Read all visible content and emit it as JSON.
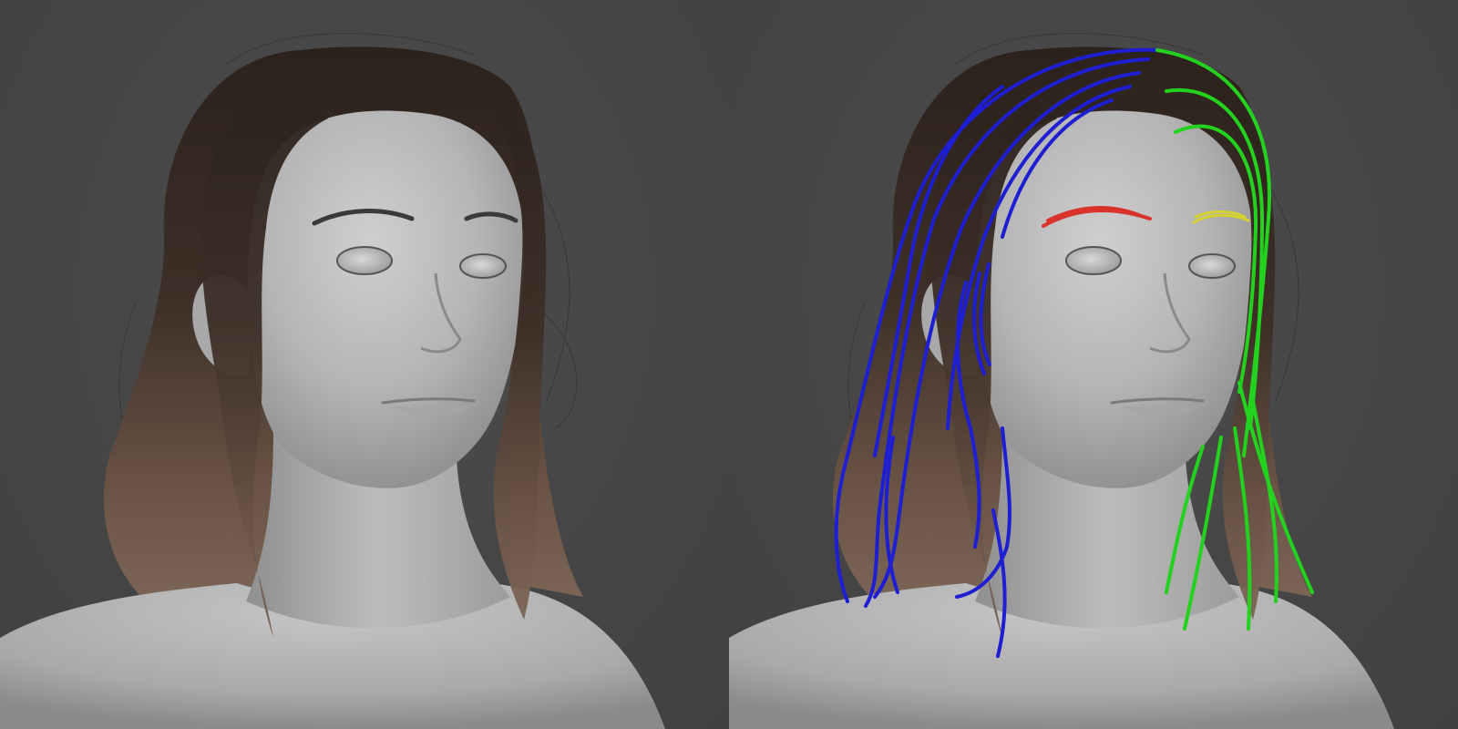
{
  "scene": {
    "background_color": "#464646",
    "skin_color": "#b9b9b9",
    "hair_color": "#4a3a30"
  },
  "panels": [
    {
      "id": "render",
      "guides_visible": false
    },
    {
      "id": "guides",
      "guides_visible": true
    }
  ],
  "guide_colors": {
    "scalp_left": "#1e1ed2",
    "scalp_right": "#23d21e",
    "eyebrow_left": "#d8322a",
    "eyebrow_right": "#d6d230"
  }
}
